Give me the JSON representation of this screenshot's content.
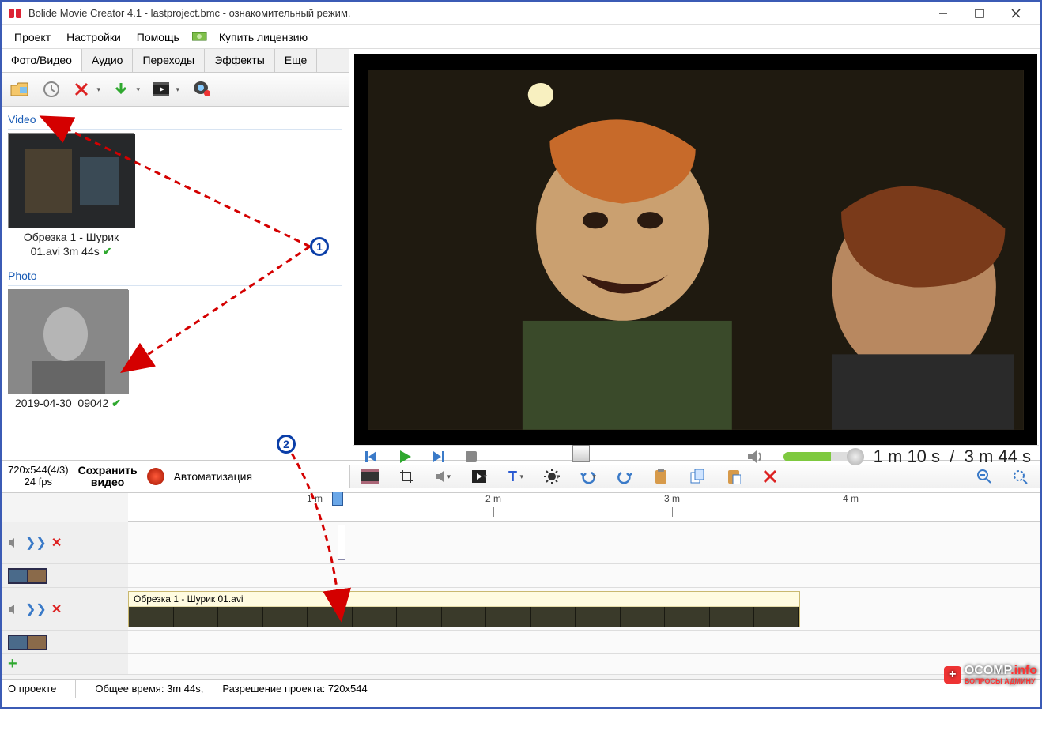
{
  "window": {
    "title": "Bolide Movie Creator 4.1 - lastproject.bmc  - ознакомительный режим."
  },
  "menu": {
    "project": "Проект",
    "settings": "Настройки",
    "help": "Помощь",
    "buy": "Купить лицензию"
  },
  "tabs": {
    "photo_video": "Фото/Видео",
    "audio": "Аудио",
    "transitions": "Переходы",
    "effects": "Эффекты",
    "more": "Еще"
  },
  "library": {
    "cat_video": "Video",
    "video_item_line1": "Обрезка 1 - Шурик",
    "video_item_line2": "01.avi 3m 44s",
    "cat_photo": "Photo",
    "photo_item": "2019-04-30_09042"
  },
  "project_info": {
    "resolution": "720x544(4/3)",
    "fps": "24 fps",
    "save_label": "Сохранить\nвидео",
    "automation": "Автоматизация"
  },
  "playback": {
    "current": "1 m 10 s",
    "sep": "/",
    "total": "3 m 44 s"
  },
  "ruler": {
    "m1": "1 m",
    "m2": "2 m",
    "m3": "3 m",
    "m4": "4 m"
  },
  "timeline": {
    "clip_label": "Обрезка 1 - Шурик 01.avi"
  },
  "status": {
    "about": "О проекте",
    "total_time": "Общее время: 3m 44s,",
    "proj_res": "Разрешение проекта:   720x544"
  },
  "annotations": {
    "badge1": "1",
    "badge2": "2"
  },
  "watermark": {
    "brand": "OCOMP",
    "tld": ".info",
    "sub": "ВОПРОСЫ АДМИНУ"
  }
}
